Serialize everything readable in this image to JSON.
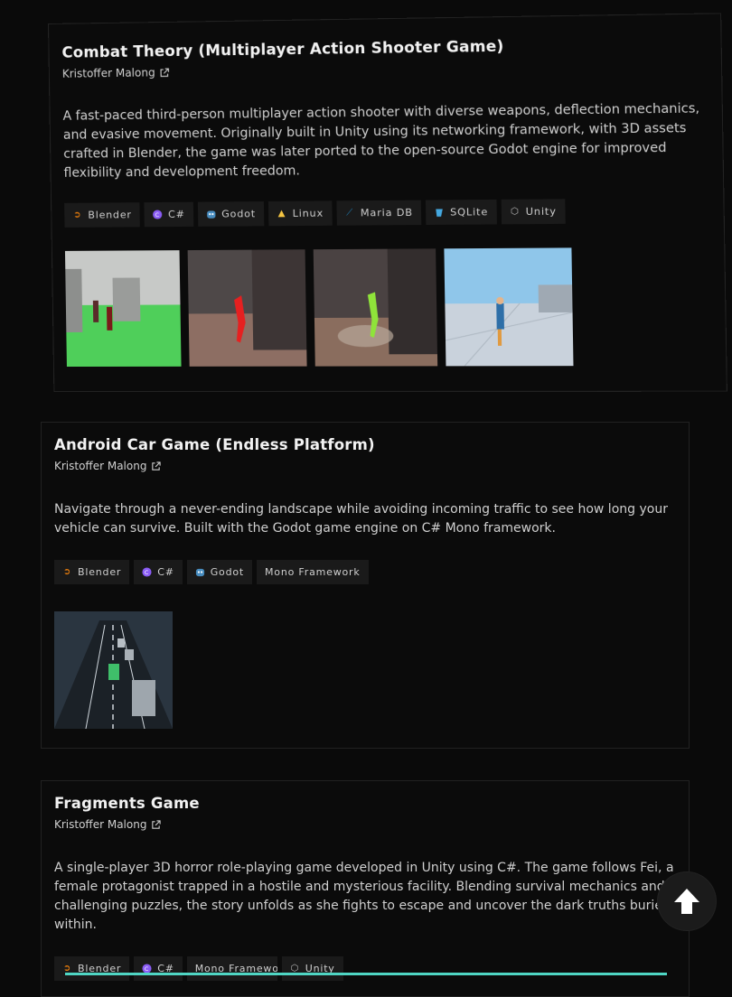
{
  "projects": [
    {
      "title": "Combat Theory (Multiplayer Action Shooter Game)",
      "author": "Kristoffer Malong",
      "description": "A fast-paced third-person multiplayer action shooter with diverse weapons, deflection mechanics, and evasive movement. Originally built in Unity using its networking framework, with 3D assets crafted in Blender, the game was later ported to the open-source Godot engine for improved flexibility and development freedom.",
      "tags": [
        {
          "label": "Blender",
          "icon": "blender-icon"
        },
        {
          "label": "C#",
          "icon": "csharp-icon"
        },
        {
          "label": "Godot",
          "icon": "godot-icon"
        },
        {
          "label": "Linux",
          "icon": "linux-icon"
        },
        {
          "label": "Maria DB",
          "icon": "mariadb-icon"
        },
        {
          "label": "SQLite",
          "icon": "sqlite-icon"
        },
        {
          "label": "Unity",
          "icon": "unity-icon"
        }
      ]
    },
    {
      "title": "Android Car Game (Endless Platform)",
      "author": "Kristoffer Malong",
      "description": "Navigate through a never-ending landscape while avoiding incoming traffic to see how long your vehicle can survive. Built with the Godot game engine on C# Mono framework.",
      "tags": [
        {
          "label": "Blender",
          "icon": "blender-icon"
        },
        {
          "label": "C#",
          "icon": "csharp-icon"
        },
        {
          "label": "Godot",
          "icon": "godot-icon"
        },
        {
          "label": "Mono Framework",
          "icon": ""
        }
      ]
    },
    {
      "title": "Fragments Game",
      "author": "Kristoffer Malong",
      "description": "A single-player 3D horror role-playing game developed in Unity using C#. The game follows Fei, a female protagonist trapped in a hostile and mysterious facility. Blending survival mechanics and challenging puzzles, the story unfolds as she fights to escape and uncover the dark truths buried within.",
      "tags": [
        {
          "label": "Blender",
          "icon": "blender-icon"
        },
        {
          "label": "C#",
          "icon": "csharp-icon"
        },
        {
          "label": "Mono Framework",
          "icon": ""
        },
        {
          "label": "Unity",
          "icon": "unity-icon"
        }
      ]
    }
  ],
  "colors": {
    "background": "#0a0a0a",
    "accent": "#4fd6c4",
    "blender": "#e87d0d",
    "csharp": "#8a5cf5",
    "godot": "#478cbf",
    "mariadb": "#1f7fb6",
    "sqlite": "#44a8e0"
  }
}
